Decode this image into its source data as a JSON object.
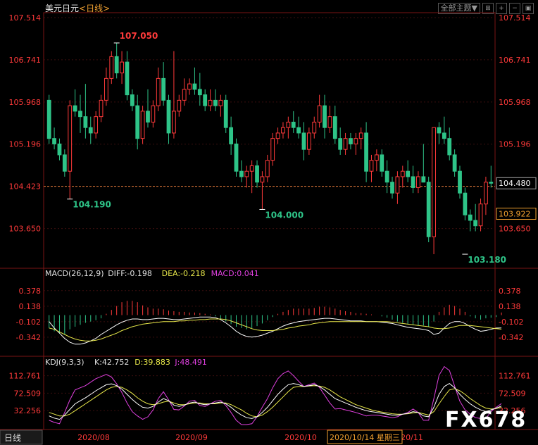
{
  "header": {
    "symbol": "美元日元",
    "period": "<日线>"
  },
  "controls": {
    "theme_label": "全部主题▼",
    "icons": [
      "fit-icon",
      "zoom-in-icon",
      "zoom-out-icon",
      "window-icon"
    ]
  },
  "colors": {
    "up": "#ff3a3a",
    "down": "#2ec488",
    "axis": "#ff3a3a",
    "dif": "#ffffff",
    "dea": "#e8e84a",
    "macd_label": "#e040e0",
    "k": "#ffffff",
    "d": "#e8e84a",
    "j": "#e040e0",
    "period": "#f0a030"
  },
  "footer": {
    "period_tab": "日线",
    "x_ticks": [
      "2020/08",
      "2020/09",
      "2020/10",
      "20/11"
    ],
    "cursor_label": "2020/10/14 星期三",
    "watermark": "FX678"
  },
  "chart_data": [
    {
      "type": "candlestick",
      "symbol": "USD/JPY",
      "y_ticks": [
        "107.514",
        "106.741",
        "105.968",
        "105.196",
        "104.423",
        "103.650"
      ],
      "ylim": [
        103.0,
        107.514
      ],
      "reference_line": 104.423,
      "right_labels": [
        "104.480",
        "103.922"
      ],
      "annotations": [
        {
          "label": "107.050",
          "x_index": 13,
          "value": 107.05
        },
        {
          "label": "104.190",
          "x_index": 4,
          "value": 104.19
        },
        {
          "label": "104.000",
          "x_index": 41,
          "value": 104.0
        },
        {
          "label": "103.180",
          "x_index": 80,
          "value": 103.18
        }
      ],
      "candles": [
        [
          106.0,
          106.1,
          105.2,
          105.3
        ],
        [
          105.3,
          105.5,
          105.1,
          105.2
        ],
        [
          105.2,
          105.3,
          104.9,
          105.0
        ],
        [
          105.0,
          105.1,
          104.6,
          104.7
        ],
        [
          104.7,
          106.0,
          104.19,
          105.9
        ],
        [
          105.9,
          106.2,
          105.7,
          105.8
        ],
        [
          105.8,
          106.1,
          105.4,
          105.7
        ],
        [
          105.7,
          106.3,
          105.3,
          105.5
        ],
        [
          105.5,
          105.7,
          105.2,
          105.4
        ],
        [
          105.4,
          105.8,
          105.3,
          105.7
        ],
        [
          105.7,
          106.1,
          105.6,
          106.0
        ],
        [
          106.0,
          106.6,
          105.9,
          106.4
        ],
        [
          106.4,
          106.9,
          106.3,
          106.8
        ],
        [
          106.8,
          107.05,
          106.4,
          106.5
        ],
        [
          106.5,
          106.9,
          106.3,
          106.7
        ],
        [
          106.7,
          106.9,
          106.0,
          106.1
        ],
        [
          106.1,
          106.2,
          105.8,
          105.9
        ],
        [
          105.9,
          106.1,
          105.1,
          105.3
        ],
        [
          105.3,
          105.9,
          105.2,
          105.8
        ],
        [
          105.8,
          106.2,
          105.5,
          105.6
        ],
        [
          105.6,
          106.0,
          105.5,
          105.9
        ],
        [
          105.9,
          106.6,
          105.8,
          106.4
        ],
        [
          106.4,
          106.7,
          105.9,
          106.0
        ],
        [
          106.0,
          106.1,
          105.2,
          105.4
        ],
        [
          105.4,
          106.9,
          105.3,
          105.8
        ],
        [
          105.8,
          106.1,
          105.7,
          106.0
        ],
        [
          106.0,
          106.4,
          105.9,
          106.2
        ],
        [
          106.2,
          106.4,
          106.1,
          106.3
        ],
        [
          106.3,
          106.6,
          106.1,
          106.2
        ],
        [
          106.2,
          106.5,
          105.9,
          106.1
        ],
        [
          106.1,
          106.2,
          105.8,
          105.9
        ],
        [
          105.9,
          106.2,
          105.8,
          106.0
        ],
        [
          106.0,
          106.2,
          105.8,
          105.9
        ],
        [
          105.9,
          106.1,
          105.7,
          106.0
        ],
        [
          106.0,
          106.1,
          105.4,
          105.5
        ],
        [
          105.5,
          105.7,
          105.0,
          105.2
        ],
        [
          105.2,
          105.3,
          104.6,
          104.7
        ],
        [
          104.7,
          104.9,
          104.5,
          104.6
        ],
        [
          104.6,
          104.8,
          104.4,
          104.7
        ],
        [
          104.7,
          104.9,
          104.3,
          104.8
        ],
        [
          104.8,
          104.9,
          104.4,
          104.5
        ],
        [
          104.5,
          104.7,
          104.0,
          104.6
        ],
        [
          104.6,
          105.0,
          104.5,
          104.9
        ],
        [
          104.9,
          105.4,
          104.8,
          105.3
        ],
        [
          105.3,
          105.5,
          105.2,
          105.4
        ],
        [
          105.4,
          105.6,
          105.3,
          105.5
        ],
        [
          105.5,
          105.7,
          105.3,
          105.6
        ],
        [
          105.6,
          105.8,
          105.4,
          105.5
        ],
        [
          105.5,
          105.7,
          105.3,
          105.4
        ],
        [
          105.4,
          105.6,
          104.9,
          105.1
        ],
        [
          105.1,
          105.5,
          105.0,
          105.4
        ],
        [
          105.4,
          105.7,
          105.3,
          105.6
        ],
        [
          105.6,
          106.1,
          105.5,
          105.9
        ],
        [
          105.9,
          106.1,
          105.3,
          105.5
        ],
        [
          105.5,
          105.9,
          105.4,
          105.7
        ],
        [
          105.7,
          105.9,
          105.2,
          105.3
        ],
        [
          105.3,
          105.5,
          105.0,
          105.1
        ],
        [
          105.1,
          105.4,
          105.0,
          105.3
        ],
        [
          105.3,
          105.4,
          105.1,
          105.2
        ],
        [
          105.2,
          105.4,
          105.0,
          105.3
        ],
        [
          105.3,
          105.5,
          105.1,
          105.4
        ],
        [
          105.4,
          105.6,
          104.5,
          104.7
        ],
        [
          104.7,
          105.0,
          104.5,
          104.9
        ],
        [
          104.9,
          105.1,
          104.7,
          105.0
        ],
        [
          105.0,
          105.1,
          104.6,
          104.7
        ],
        [
          104.7,
          104.9,
          104.3,
          104.5
        ],
        [
          104.5,
          104.6,
          104.2,
          104.3
        ],
        [
          104.3,
          104.7,
          104.1,
          104.6
        ],
        [
          104.6,
          104.8,
          104.4,
          104.7
        ],
        [
          104.7,
          104.9,
          104.5,
          104.6
        ],
        [
          104.6,
          104.8,
          104.3,
          104.4
        ],
        [
          104.4,
          104.7,
          104.3,
          104.6
        ],
        [
          104.6,
          105.2,
          104.5,
          104.5
        ],
        [
          104.5,
          104.6,
          103.4,
          103.5
        ],
        [
          103.5,
          105.4,
          103.18,
          105.5
        ],
        [
          105.5,
          105.6,
          105.2,
          105.4
        ],
        [
          105.4,
          105.7,
          105.2,
          105.3
        ],
        [
          105.3,
          105.5,
          104.9,
          105.0
        ],
        [
          105.0,
          105.1,
          104.6,
          104.7
        ],
        [
          104.7,
          104.8,
          104.2,
          104.3
        ],
        [
          104.3,
          104.4,
          103.8,
          103.9
        ],
        [
          103.9,
          104.0,
          103.6,
          103.8
        ],
        [
          103.8,
          104.1,
          103.6,
          103.7
        ],
        [
          103.7,
          104.2,
          103.6,
          104.1
        ],
        [
          104.1,
          104.6,
          103.9,
          104.5
        ],
        [
          104.5,
          104.8,
          104.4,
          104.48
        ]
      ]
    },
    {
      "type": "macd",
      "params": "MACD(26,12,9)",
      "dif_label": "DIFF:-0.198",
      "dea_label": "DEA:-0.218",
      "macd_label": "MACD:0.041",
      "y_ticks": [
        "0.378",
        "0.138",
        "-0.102",
        "-0.342"
      ],
      "ylim": [
        -0.55,
        0.55
      ],
      "hist": [
        -0.2,
        -0.25,
        -0.28,
        -0.3,
        -0.22,
        -0.18,
        -0.15,
        -0.12,
        -0.1,
        -0.08,
        -0.05,
        0.02,
        0.08,
        0.14,
        0.2,
        0.22,
        0.22,
        0.2,
        0.15,
        0.12,
        0.1,
        0.1,
        0.09,
        0.07,
        0.06,
        0.05,
        0.05,
        0.04,
        0.04,
        0.03,
        0.02,
        0.01,
        -0.02,
        -0.06,
        -0.1,
        -0.14,
        -0.18,
        -0.2,
        -0.22,
        -0.2,
        -0.17,
        -0.13,
        -0.08,
        -0.03,
        0.02,
        0.05,
        0.08,
        0.1,
        0.1,
        0.1,
        0.1,
        0.11,
        0.13,
        0.13,
        0.12,
        0.1,
        0.08,
        0.06,
        0.05,
        0.03,
        0.03,
        0.02,
        0.01,
        0.0,
        -0.02,
        -0.04,
        -0.07,
        -0.1,
        -0.12,
        -0.14,
        -0.15,
        -0.16,
        -0.16,
        -0.18,
        -0.1,
        0.05,
        0.12,
        0.16,
        0.14,
        0.1,
        0.05,
        -0.02,
        -0.05,
        -0.07,
        -0.05,
        -0.04,
        -0.03,
        0.04
      ],
      "dif": [
        -0.1,
        -0.2,
        -0.28,
        -0.36,
        -0.42,
        -0.45,
        -0.45,
        -0.43,
        -0.4,
        -0.36,
        -0.3,
        -0.25,
        -0.2,
        -0.15,
        -0.11,
        -0.08,
        -0.06,
        -0.06,
        -0.07,
        -0.07,
        -0.06,
        -0.05,
        -0.05,
        -0.06,
        -0.07,
        -0.07,
        -0.06,
        -0.05,
        -0.04,
        -0.03,
        -0.03,
        -0.03,
        -0.04,
        -0.07,
        -0.12,
        -0.18,
        -0.25,
        -0.3,
        -0.33,
        -0.34,
        -0.33,
        -0.31,
        -0.28,
        -0.25,
        -0.21,
        -0.17,
        -0.14,
        -0.12,
        -0.1,
        -0.09,
        -0.08,
        -0.07,
        -0.06,
        -0.05,
        -0.05,
        -0.06,
        -0.07,
        -0.08,
        -0.09,
        -0.09,
        -0.09,
        -0.1,
        -0.1,
        -0.1,
        -0.11,
        -0.12,
        -0.13,
        -0.15,
        -0.17,
        -0.19,
        -0.2,
        -0.21,
        -0.22,
        -0.24,
        -0.3,
        -0.28,
        -0.2,
        -0.13,
        -0.1,
        -0.1,
        -0.13,
        -0.18,
        -0.22,
        -0.25,
        -0.24,
        -0.22,
        -0.2,
        -0.198
      ],
      "dea": [
        -0.2,
        -0.22,
        -0.26,
        -0.3,
        -0.34,
        -0.37,
        -0.39,
        -0.4,
        -0.4,
        -0.39,
        -0.37,
        -0.34,
        -0.31,
        -0.28,
        -0.24,
        -0.21,
        -0.18,
        -0.16,
        -0.14,
        -0.13,
        -0.12,
        -0.11,
        -0.1,
        -0.1,
        -0.1,
        -0.09,
        -0.09,
        -0.08,
        -0.08,
        -0.07,
        -0.07,
        -0.06,
        -0.06,
        -0.06,
        -0.07,
        -0.09,
        -0.12,
        -0.15,
        -0.18,
        -0.21,
        -0.23,
        -0.24,
        -0.24,
        -0.24,
        -0.23,
        -0.22,
        -0.2,
        -0.19,
        -0.17,
        -0.16,
        -0.15,
        -0.13,
        -0.12,
        -0.11,
        -0.1,
        -0.1,
        -0.1,
        -0.1,
        -0.1,
        -0.1,
        -0.1,
        -0.1,
        -0.1,
        -0.1,
        -0.1,
        -0.1,
        -0.11,
        -0.12,
        -0.13,
        -0.14,
        -0.15,
        -0.16,
        -0.17,
        -0.18,
        -0.2,
        -0.21,
        -0.21,
        -0.2,
        -0.18,
        -0.16,
        -0.16,
        -0.16,
        -0.17,
        -0.18,
        -0.19,
        -0.2,
        -0.21,
        -0.218
      ]
    },
    {
      "type": "kdj",
      "params": "KDJ(9,3,3)",
      "k_label": "K:42.752",
      "d_label": "D:39.883",
      "j_label": "J:48.491",
      "y_ticks": [
        "112.761",
        "72.509",
        "32.256"
      ],
      "ylim": [
        0,
        135
      ],
      "k": [
        20,
        15,
        12,
        22,
        35,
        48,
        55,
        62,
        70,
        78,
        85,
        92,
        94,
        90,
        82,
        70,
        58,
        48,
        40,
        38,
        42,
        52,
        60,
        55,
        45,
        42,
        45,
        50,
        52,
        48,
        46,
        48,
        50,
        52,
        48,
        40,
        30,
        22,
        16,
        14,
        18,
        28,
        40,
        55,
        70,
        82,
        92,
        95,
        92,
        88,
        90,
        92,
        88,
        80,
        70,
        60,
        55,
        50,
        45,
        40,
        36,
        32,
        30,
        28,
        26,
        24,
        22,
        22,
        24,
        26,
        30,
        28,
        20,
        18,
        40,
        70,
        88,
        95,
        85,
        70,
        58,
        48,
        40,
        34,
        30,
        34,
        38,
        42.752
      ],
      "d": [
        28,
        24,
        20,
        20,
        24,
        32,
        40,
        48,
        56,
        64,
        72,
        80,
        86,
        88,
        86,
        80,
        72,
        62,
        54,
        48,
        46,
        48,
        52,
        54,
        50,
        46,
        46,
        48,
        50,
        50,
        48,
        48,
        48,
        50,
        50,
        46,
        40,
        34,
        26,
        20,
        18,
        22,
        30,
        40,
        52,
        64,
        76,
        86,
        88,
        88,
        89,
        90,
        89,
        86,
        80,
        72,
        64,
        58,
        52,
        46,
        42,
        38,
        34,
        31,
        29,
        27,
        25,
        24,
        24,
        25,
        27,
        28,
        25,
        22,
        30,
        48,
        65,
        80,
        83,
        78,
        70,
        60,
        52,
        44,
        38,
        36,
        37,
        39.883
      ],
      "j": [
        10,
        5,
        2,
        28,
        57,
        80,
        85,
        90,
        98,
        106,
        111,
        116,
        110,
        94,
        74,
        50,
        30,
        20,
        12,
        18,
        34,
        60,
        76,
        57,
        35,
        34,
        43,
        54,
        56,
        44,
        42,
        48,
        54,
        56,
        44,
        28,
        10,
        0,
        0,
        2,
        18,
        40,
        60,
        85,
        106,
        118,
        124,
        113,
        100,
        88,
        92,
        96,
        86,
        68,
        50,
        36,
        37,
        34,
        31,
        28,
        24,
        20,
        22,
        22,
        20,
        18,
        16,
        18,
        24,
        28,
        36,
        28,
        10,
        10,
        60,
        114,
        134,
        125,
        89,
        54,
        34,
        24,
        16,
        14,
        14,
        30,
        40,
        48.491
      ]
    }
  ]
}
